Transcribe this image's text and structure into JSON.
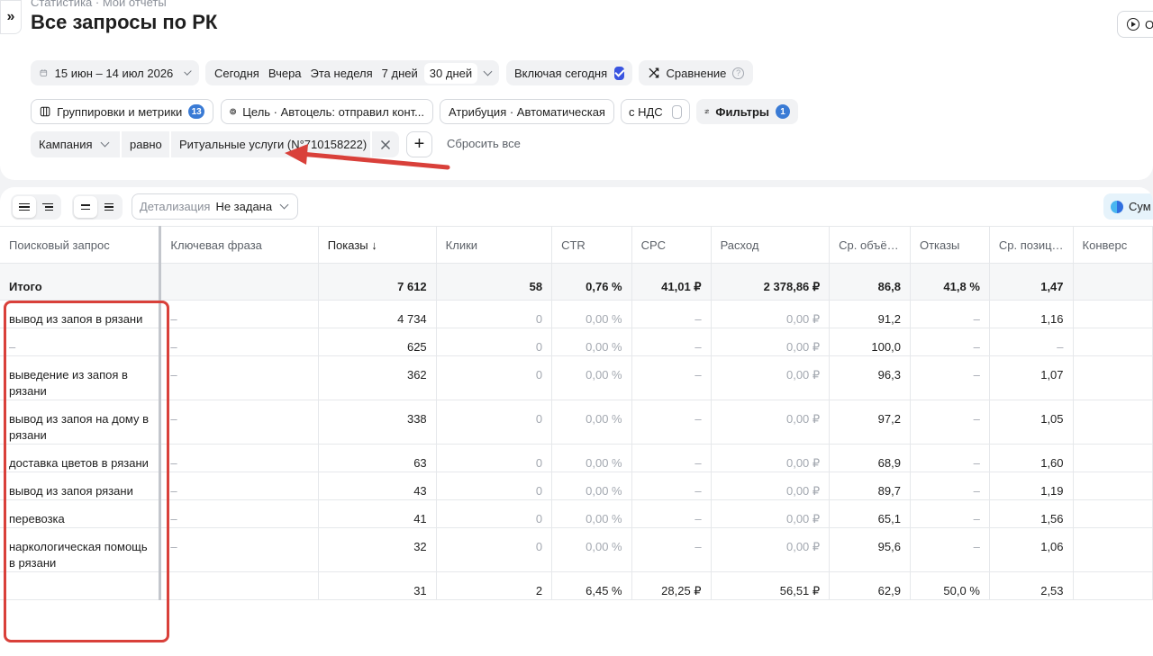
{
  "header": {
    "breadcrumb": "Статистика · Мои отчеты",
    "title": "Все запросы по РК",
    "corner_button": "О"
  },
  "toolbar": {
    "date_range": "15 июн – 14 июл 2026",
    "presets": [
      "Сегодня",
      "Вчера",
      "Эта неделя",
      "7 дней",
      "30 дней"
    ],
    "include_today": "Включая сегодня",
    "include_today_checked": true,
    "compare": "Сравнение",
    "groupings": "Группировки и метрики",
    "groupings_count": "13",
    "goal": "Цель · Автоцель: отправил конт...",
    "attribution": "Атрибуция · Автоматическая",
    "vat": "с НДС",
    "filters": "Фильтры",
    "filters_count": "1"
  },
  "filter": {
    "field": "Кампания",
    "operator": "равно",
    "value": "Ритуальные услуги (N°710158222)",
    "reset": "Сбросить все"
  },
  "table_controls": {
    "detail_label": "Детализация",
    "detail_value": "Не задана",
    "sum_button": "Сум"
  },
  "table": {
    "columns": [
      "Поисковый запрос",
      "Ключевая фраза",
      "Показы ↓",
      "Клики",
      "CTR",
      "CPC",
      "Расход",
      "Ср. объё…",
      "Отказы",
      "Ср. позиц…",
      "Конверс"
    ],
    "total": [
      "Итого",
      "",
      "7 612",
      "58",
      "0,76 %",
      "41,01 ₽",
      "2 378,86 ₽",
      "86,8",
      "41,8 %",
      "1,47",
      ""
    ],
    "rows": [
      [
        "вывод из запоя в рязани",
        "–",
        "4 734",
        "0",
        "0,00 %",
        "–",
        "0,00 ₽",
        "91,2",
        "–",
        "1,16",
        ""
      ],
      [
        "–",
        "–",
        "625",
        "0",
        "0,00 %",
        "–",
        "0,00 ₽",
        "100,0",
        "–",
        "–",
        ""
      ],
      [
        "выведение из запоя в рязани",
        "–",
        "362",
        "0",
        "0,00 %",
        "–",
        "0,00 ₽",
        "96,3",
        "–",
        "1,07",
        ""
      ],
      [
        "вывод из запоя на дому в рязани",
        "–",
        "338",
        "0",
        "0,00 %",
        "–",
        "0,00 ₽",
        "97,2",
        "–",
        "1,05",
        ""
      ],
      [
        "доставка цветов в рязани",
        "–",
        "63",
        "0",
        "0,00 %",
        "–",
        "0,00 ₽",
        "68,9",
        "–",
        "1,60",
        ""
      ],
      [
        "вывод из запоя рязани",
        "–",
        "43",
        "0",
        "0,00 %",
        "–",
        "0,00 ₽",
        "89,7",
        "–",
        "1,19",
        ""
      ],
      [
        "перевозка",
        "–",
        "41",
        "0",
        "0,00 %",
        "–",
        "0,00 ₽",
        "65,1",
        "–",
        "1,56",
        ""
      ],
      [
        "наркологическая помощь в рязани",
        "–",
        "32",
        "0",
        "0,00 %",
        "–",
        "0,00 ₽",
        "95,6",
        "–",
        "1,06",
        ""
      ],
      [
        "",
        "",
        "31",
        "2",
        "6,45 %",
        "28,25 ₽",
        "56,51 ₽",
        "62,9",
        "50,0 %",
        "2,53",
        ""
      ]
    ]
  },
  "colors": {
    "accent": "#3a7bd5",
    "annotation": "#d9403a"
  }
}
